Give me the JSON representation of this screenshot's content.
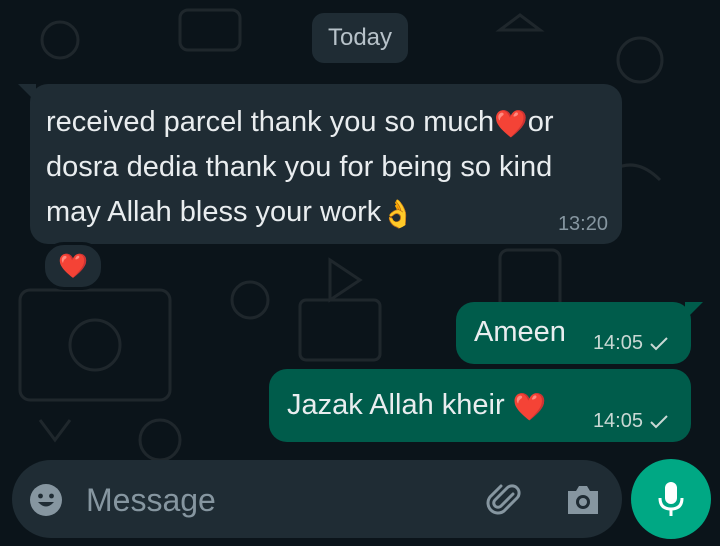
{
  "date_divider": "Today",
  "incoming": {
    "line1": "received parcel thank you so much",
    "line1b": "or",
    "line2": "dosra dedia thank you for being so kind",
    "line3": "may Allah bless your work",
    "emoji_heart": "❤️",
    "emoji_hand": "👌",
    "time": "13:20",
    "reaction": "❤️"
  },
  "outgoing": [
    {
      "text": "Ameen",
      "time": "14:05",
      "status_icon": "single-check-icon"
    },
    {
      "text": "Jazak Allah kheir",
      "emoji": "❤️",
      "time": "14:05",
      "status_icon": "single-check-icon"
    }
  ],
  "composer": {
    "placeholder": "Message",
    "icons": [
      "emoji-icon",
      "attach-icon",
      "camera-icon",
      "mic-icon"
    ]
  },
  "colors": {
    "background": "#0b141a",
    "incoming_bubble": "#1f2c34",
    "outgoing_bubble": "#005c4b",
    "accent": "#00a884"
  }
}
